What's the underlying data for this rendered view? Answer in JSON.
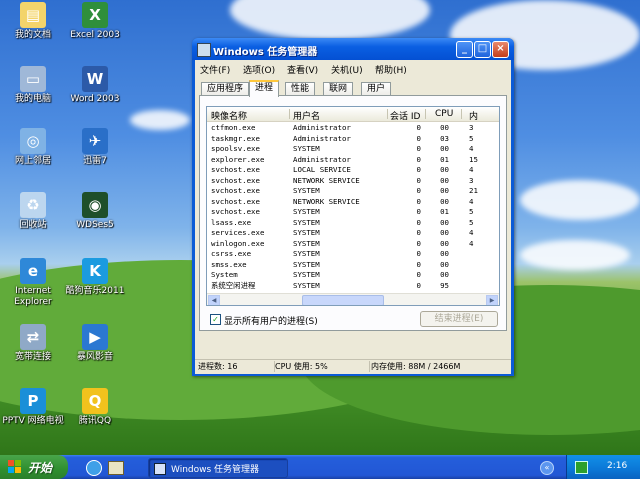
{
  "desktop": {
    "icons": [
      {
        "label": "我的文档",
        "name": "my-documents-icon",
        "color": "#f3d46b",
        "glyph": "▤"
      },
      {
        "label": "Excel 2003",
        "name": "excel-2003-icon",
        "color": "#2f8f3b",
        "glyph": "X"
      },
      {
        "label": "我的电脑",
        "name": "my-computer-icon",
        "color": "#9fb8d8",
        "glyph": "▭"
      },
      {
        "label": "Word 2003",
        "name": "word-2003-icon",
        "color": "#2c5aa8",
        "glyph": "W"
      },
      {
        "label": "网上邻居",
        "name": "network-places-icon",
        "color": "#7fb2e5",
        "glyph": "◎"
      },
      {
        "label": "迅雷7",
        "name": "xunlei-icon",
        "color": "#2a6fc8",
        "glyph": "✈"
      },
      {
        "label": "回收站",
        "name": "recycle-bin-icon",
        "color": "#bcd6ef",
        "glyph": "♻"
      },
      {
        "label": "WDSes5",
        "name": "wdses5-icon",
        "color": "#1e4f2a",
        "glyph": "◉"
      },
      {
        "label": "Internet Explorer",
        "name": "internet-explorer-icon",
        "color": "#2e88d8",
        "glyph": "e"
      },
      {
        "label": "酷狗音乐2011",
        "name": "kugou-icon",
        "color": "#1b9be0",
        "glyph": "K"
      },
      {
        "label": "宽带连接",
        "name": "broadband-connection-icon",
        "color": "#8fa9c7",
        "glyph": "⇄"
      },
      {
        "label": "暴风影音",
        "name": "baofeng-icon",
        "color": "#2b78d2",
        "glyph": "▶"
      },
      {
        "label": "PPTV 网络电视",
        "name": "pptv-icon",
        "color": "#1a8fd8",
        "glyph": "P"
      },
      {
        "label": "腾讯QQ",
        "name": "tencent-qq-icon",
        "color": "#f2c21d",
        "glyph": "Q"
      }
    ]
  },
  "window": {
    "title": "Windows 任务管理器",
    "controls": {
      "minimize": "_",
      "maximize": "□",
      "close": "×"
    },
    "menu": [
      "文件(F)",
      "选项(O)",
      "查看(V)",
      "关机(U)",
      "帮助(H)"
    ],
    "tabs": [
      "应用程序",
      "进程",
      "性能",
      "联网",
      "用户"
    ],
    "active_tab": "进程",
    "columns": [
      "映像名称",
      "用户名",
      "会话 ID",
      "CPU",
      "内"
    ],
    "processes": [
      {
        "name": "ctfmon.exe",
        "user": "Administrator",
        "session": "0",
        "cpu": "00",
        "mem": "3"
      },
      {
        "name": "taskmgr.exe",
        "user": "Administrator",
        "session": "0",
        "cpu": "03",
        "mem": "5"
      },
      {
        "name": "spoolsv.exe",
        "user": "SYSTEM",
        "session": "0",
        "cpu": "00",
        "mem": "4"
      },
      {
        "name": "explorer.exe",
        "user": "Administrator",
        "session": "0",
        "cpu": "01",
        "mem": "15"
      },
      {
        "name": "svchost.exe",
        "user": "LOCAL SERVICE",
        "session": "0",
        "cpu": "00",
        "mem": "4"
      },
      {
        "name": "svchost.exe",
        "user": "NETWORK SERVICE",
        "session": "0",
        "cpu": "00",
        "mem": "3"
      },
      {
        "name": "svchost.exe",
        "user": "SYSTEM",
        "session": "0",
        "cpu": "00",
        "mem": "21"
      },
      {
        "name": "svchost.exe",
        "user": "NETWORK SERVICE",
        "session": "0",
        "cpu": "00",
        "mem": "4"
      },
      {
        "name": "svchost.exe",
        "user": "SYSTEM",
        "session": "0",
        "cpu": "01",
        "mem": "5"
      },
      {
        "name": "lsass.exe",
        "user": "SYSTEM",
        "session": "0",
        "cpu": "00",
        "mem": "5"
      },
      {
        "name": "services.exe",
        "user": "SYSTEM",
        "session": "0",
        "cpu": "00",
        "mem": "4"
      },
      {
        "name": "winlogon.exe",
        "user": "SYSTEM",
        "session": "0",
        "cpu": "00",
        "mem": "4"
      },
      {
        "name": "csrss.exe",
        "user": "SYSTEM",
        "session": "0",
        "cpu": "00",
        "mem": ""
      },
      {
        "name": "smss.exe",
        "user": "SYSTEM",
        "session": "0",
        "cpu": "00",
        "mem": ""
      },
      {
        "name": "System",
        "user": "SYSTEM",
        "session": "0",
        "cpu": "00",
        "mem": ""
      },
      {
        "name": "系统空闲进程",
        "user": "SYSTEM",
        "session": "0",
        "cpu": "95",
        "mem": ""
      }
    ],
    "show_all_users_label": "显示所有用户的进程(S)",
    "show_all_users_checked": "✓",
    "end_process_label": "结束进程(E)",
    "status": {
      "processes": "进程数: 16",
      "cpu": "CPU 使用: 5%",
      "commit": "内存使用: 88M / 2466M"
    }
  },
  "taskbar": {
    "start_label": "开始",
    "task_button_label": "Windows 任务管理器",
    "tray_chevron": "«",
    "clock": "2:16"
  },
  "colors": {
    "xp_blue": "#0b5bd6",
    "start_green": "#2f8f2f",
    "panel_bg": "#ece9d8"
  }
}
